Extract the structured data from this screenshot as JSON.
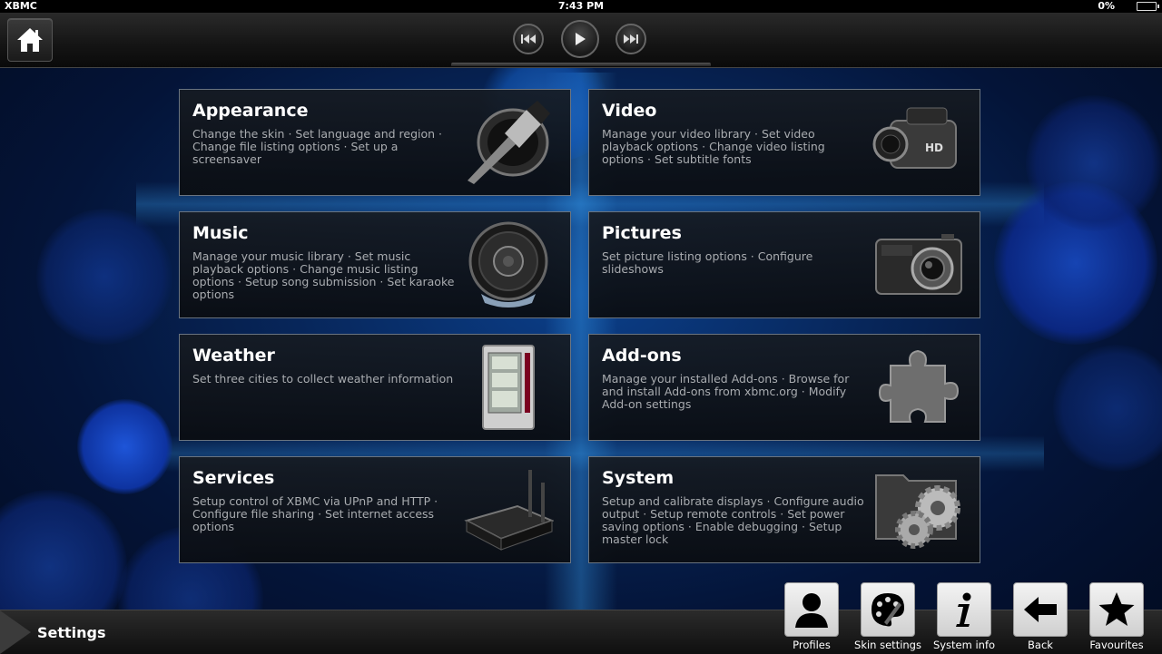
{
  "status_bar": {
    "app_name": "XBMC",
    "clock": "7:43 PM",
    "battery": "0%"
  },
  "tiles": [
    {
      "title": "Appearance",
      "description": "Change the skin · Set language and region · Change file listing options · Set up a screensaver",
      "icon": "paintbrush-icon"
    },
    {
      "title": "Video",
      "description": "Manage your video library · Set video playback options · Change video listing options · Set subtitle fonts",
      "icon": "camcorder-icon"
    },
    {
      "title": "Music",
      "description": "Manage your music library · Set music playback options · Change music listing options · Setup song submission · Set karaoke options",
      "icon": "speaker-icon"
    },
    {
      "title": "Pictures",
      "description": "Set picture listing options · Configure slideshows",
      "icon": "camera-icon"
    },
    {
      "title": "Weather",
      "description": "Set three cities to collect weather information",
      "icon": "weather-station-icon"
    },
    {
      "title": "Add-ons",
      "description": "Manage your installed Add-ons · Browse for and install Add-ons from xbmc.org · Modify Add-on settings",
      "icon": "puzzle-icon"
    },
    {
      "title": "Services",
      "description": "Setup control of XBMC via UPnP and HTTP · Configure file sharing · Set internet access options",
      "icon": "router-icon"
    },
    {
      "title": "System",
      "description": "Setup and calibrate displays · Configure audio output · Setup remote controls · Set power saving options · Enable debugging · Setup master lock",
      "icon": "gears-folder-icon"
    }
  ],
  "bottom_bar": {
    "label": "Settings"
  },
  "footer_buttons": [
    {
      "label": "Profiles",
      "icon": "person-icon"
    },
    {
      "label": "Skin settings",
      "icon": "palette-icon"
    },
    {
      "label": "System info",
      "icon": "info-icon"
    },
    {
      "label": "Back",
      "icon": "arrow-left-icon"
    },
    {
      "label": "Favourites",
      "icon": "star-icon"
    }
  ],
  "colors": {
    "tile_border": "#6a7480",
    "description_text": "#a9acb0",
    "background": "#07265a"
  }
}
